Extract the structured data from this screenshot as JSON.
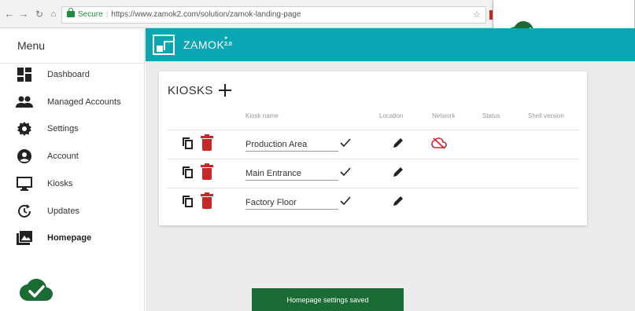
{
  "browser": {
    "secure_label": "Secure",
    "url": "https://www.zamok2.com/solution/zamok-landing-page"
  },
  "sidebar": {
    "title": "Menu",
    "items": [
      {
        "label": "Dashboard",
        "icon": "dashboard-icon"
      },
      {
        "label": "Managed Accounts",
        "icon": "people-icon"
      },
      {
        "label": "Settings",
        "icon": "gear-icon"
      },
      {
        "label": "Account",
        "icon": "account-circle-icon"
      },
      {
        "label": "Kiosks",
        "icon": "monitor-icon"
      },
      {
        "label": "Updates",
        "icon": "updates-icon"
      },
      {
        "label": "Homepage",
        "icon": "image-icon",
        "active": true
      }
    ]
  },
  "header": {
    "brand": "ZAMOK",
    "version": "2.0",
    "color": "#0aa6b4"
  },
  "kiosks": {
    "title": "KIOSKS",
    "columns": [
      "Kiosk name",
      "Location",
      "Network",
      "Status",
      "Shell version"
    ],
    "rows": [
      {
        "name": "Production Area",
        "network": "cloud-off-icon"
      },
      {
        "name": "Main Entrance",
        "network": ""
      },
      {
        "name": "Factory Floor",
        "network": ""
      }
    ]
  },
  "toast": {
    "message": "Homepage settings saved"
  },
  "colors": {
    "accent": "#0aa6b4",
    "delete": "#c62828",
    "success": "#1b6b34"
  }
}
